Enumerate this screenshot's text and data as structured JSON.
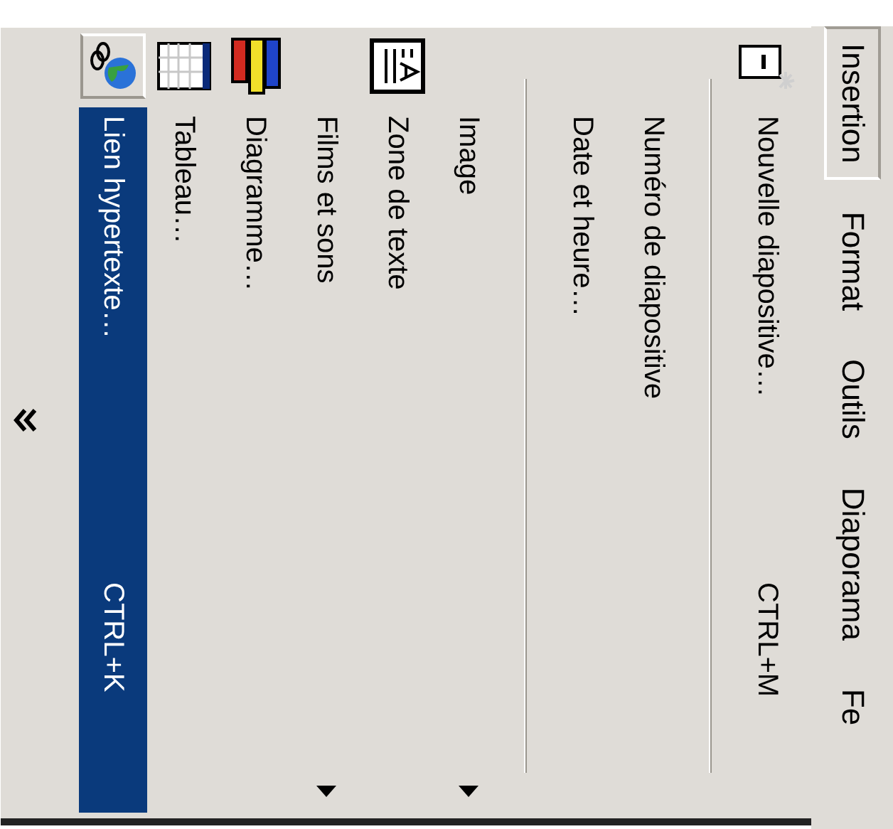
{
  "menu_bar": [
    {
      "label": "Insertion",
      "selected": true
    },
    {
      "label": "Format",
      "selected": false
    },
    {
      "label": "Outils",
      "selected": false
    },
    {
      "label": "Diaporama",
      "selected": false
    },
    {
      "label": "Fe",
      "selected": false
    }
  ],
  "menu": {
    "items": [
      {
        "kind": "command",
        "label": "Nouvelle diapositive…",
        "shortcut": "CTRL+M",
        "submenu": false,
        "selected": false
      },
      {
        "kind": "separator"
      },
      {
        "kind": "command",
        "label": "Numéro de diapositive",
        "submenu": false,
        "selected": false
      },
      {
        "kind": "command",
        "label": "Date et heure…",
        "submenu": false,
        "selected": false
      },
      {
        "kind": "separator"
      },
      {
        "kind": "command",
        "label": "Image",
        "submenu": true,
        "selected": false
      },
      {
        "kind": "command",
        "label": "Zone de texte",
        "submenu": false,
        "selected": false
      },
      {
        "kind": "command",
        "label": "Films et sons",
        "submenu": true,
        "selected": false
      },
      {
        "kind": "command",
        "label": "Diagramme…",
        "submenu": false,
        "selected": false
      },
      {
        "kind": "command",
        "label": "Tableau…",
        "submenu": false,
        "selected": false
      },
      {
        "kind": "command",
        "label": "Lien hypertexte…",
        "shortcut": "CTRL+K",
        "submenu": false,
        "selected": true
      }
    ]
  }
}
